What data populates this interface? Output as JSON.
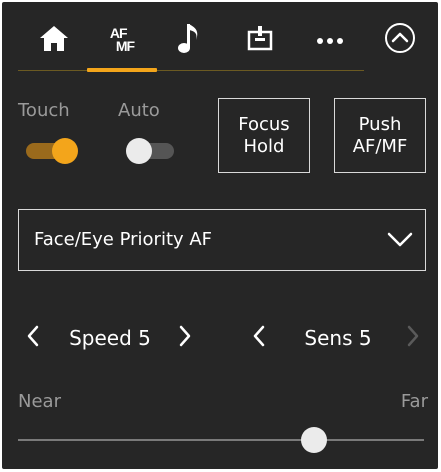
{
  "nav": {
    "items": [
      {
        "name": "home",
        "icon": "home-icon"
      },
      {
        "name": "af-mf",
        "icon": "af-mf-icon",
        "label_top": "AF",
        "label_bottom": "MF",
        "active": true
      },
      {
        "name": "audio",
        "icon": "music-note-icon"
      },
      {
        "name": "video",
        "icon": "camera-settings-icon"
      },
      {
        "name": "more",
        "icon": "more-icon"
      },
      {
        "name": "collapse",
        "icon": "chevron-up-circle-icon"
      }
    ],
    "accent_color": "#f3a51b"
  },
  "toggles": {
    "touch": {
      "label": "Touch",
      "on": true
    },
    "auto": {
      "label": "Auto",
      "on": false
    }
  },
  "buttons": {
    "focus_hold": "Focus\nHold",
    "push_af_mf": "Push\nAF/MF"
  },
  "af_mode": {
    "selected": "Face/Eye Priority AF"
  },
  "speed": {
    "value": "Speed 5"
  },
  "sens": {
    "value": "Sens 5",
    "next_disabled": true
  },
  "focus": {
    "near_label": "Near",
    "far_label": "Far",
    "position": 0.73
  }
}
